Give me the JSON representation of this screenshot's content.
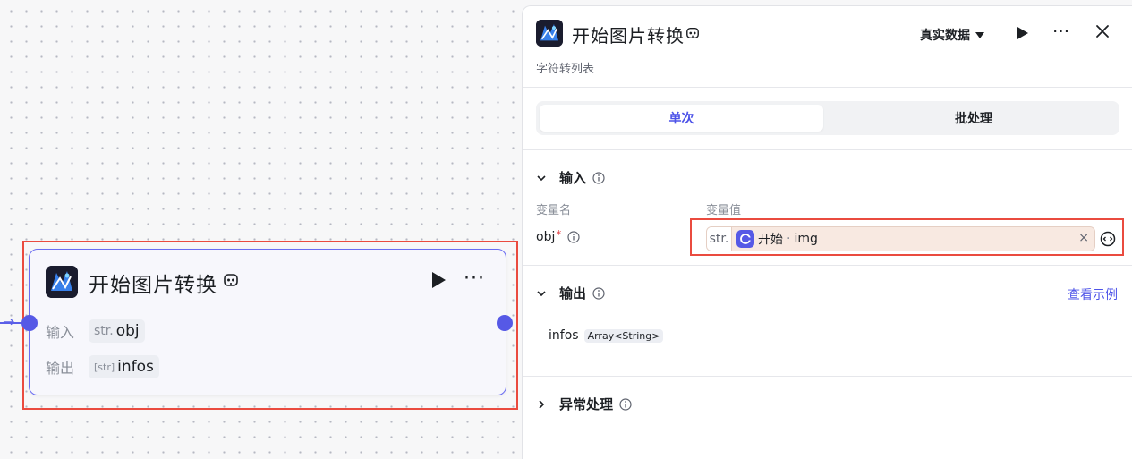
{
  "node": {
    "title": "开始图片转换",
    "input_label": "输入",
    "input_type": "str.",
    "input_name": "obj",
    "output_label": "输出",
    "output_type": "[str]",
    "output_name": "infos"
  },
  "panel": {
    "title": "开始图片转换",
    "description": "字符转列表",
    "data_source": "真实数据",
    "tabs": [
      "单次",
      "批处理"
    ],
    "input_section": {
      "title": "输入",
      "col_name": "变量名",
      "col_value": "变量值",
      "var_name": "obj",
      "required_mark": "*",
      "value_type": "str.",
      "ref_node": "开始",
      "ref_separator": "·",
      "ref_var": "img",
      "clear_symbol": "×"
    },
    "output_section": {
      "title": "输出",
      "view_example": "查看示例",
      "out_name": "infos",
      "out_type": "Array<String>"
    },
    "exception_section": {
      "title": "异常处理"
    }
  },
  "colors": {
    "accent": "#4d53e8",
    "port": "#5659e6",
    "highlight": "#ea4b3f",
    "ref_bg": "#f8e9e1"
  },
  "icons": {
    "logo": "app-logo-icon",
    "mcp": "mcp-icon",
    "play": "play-icon",
    "more": "more-icon",
    "close": "close-icon",
    "info": "info-icon",
    "chevron_down": "chevron-down-icon",
    "chevron_right": "chevron-right-icon",
    "ref_source": "start-node-icon",
    "ref_picker": "ref-picker-icon"
  }
}
